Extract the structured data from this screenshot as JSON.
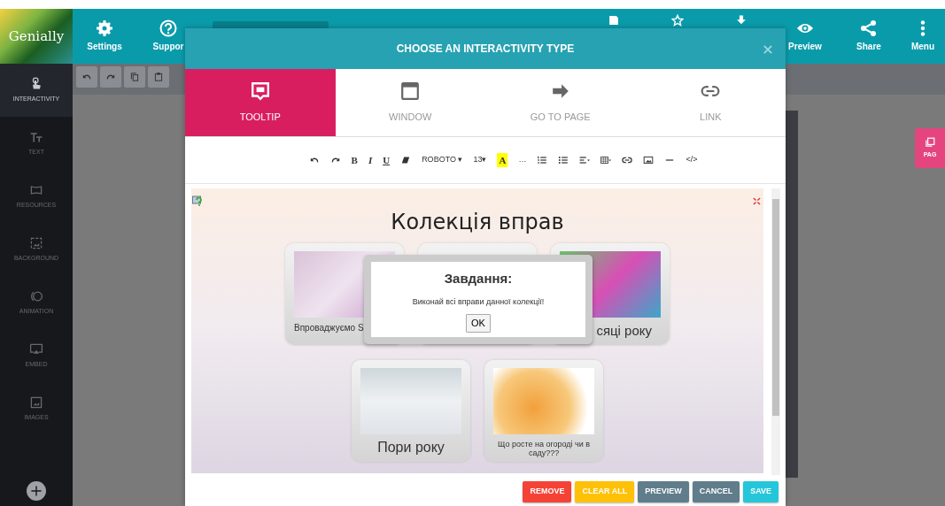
{
  "header": {
    "logo": "Genially",
    "left_items": [
      {
        "kind": "gear",
        "label": "Settings"
      },
      {
        "kind": "help",
        "label": "Suppor"
      }
    ],
    "right_items": [
      {
        "kind": "save"
      },
      {
        "kind": "star"
      },
      {
        "kind": "download"
      },
      {
        "kind": "eye",
        "label": "Preview"
      },
      {
        "kind": "share",
        "label": "Share"
      },
      {
        "kind": "dots",
        "label": "Menu"
      }
    ]
  },
  "sidebar": {
    "items": [
      {
        "kind": "hand",
        "label": "INTERACTIVITY",
        "selected": true
      },
      {
        "kind": "text",
        "label": "TEXT",
        "selected": false
      },
      {
        "kind": "resources",
        "label": "RESOURCES",
        "selected": false
      },
      {
        "kind": "background",
        "label": "BACKGROUND",
        "selected": false
      },
      {
        "kind": "animation",
        "label": "ANIMATION",
        "selected": false
      },
      {
        "kind": "embed",
        "label": "EMBED",
        "selected": false
      },
      {
        "kind": "images",
        "label": "IMAGES",
        "selected": false
      }
    ]
  },
  "canvas_toolbar": [
    {
      "kind": "undo"
    },
    {
      "kind": "redo"
    },
    {
      "kind": "copy"
    },
    {
      "kind": "paste"
    }
  ],
  "page_button": {
    "label": "PAG"
  },
  "modal": {
    "title": "CHOOSE AN INTERACTIVITY TYPE",
    "tabs": [
      {
        "kind": "tooltip",
        "label": "TOOLTIP",
        "selected": true
      },
      {
        "kind": "window",
        "label": "WINDOW",
        "selected": false
      },
      {
        "kind": "arrow",
        "label": "GO TO PAGE",
        "selected": false
      },
      {
        "kind": "link",
        "label": "LINK",
        "selected": false
      }
    ],
    "editor_toolbar": [
      {
        "kind": "undo"
      },
      {
        "kind": "redo"
      },
      {
        "kind": "text",
        "text": "B"
      },
      {
        "kind": "text",
        "text": "I"
      },
      {
        "kind": "text",
        "text": "U"
      },
      {
        "kind": "eraser"
      },
      {
        "kind": "text",
        "text": "ROBOTO ▾"
      },
      {
        "kind": "text",
        "text": "13▾"
      },
      {
        "kind": "highlight",
        "text": "A"
      },
      {
        "kind": "text",
        "text": "…"
      },
      {
        "kind": "ol"
      },
      {
        "kind": "ul"
      },
      {
        "kind": "align"
      },
      {
        "kind": "table"
      },
      {
        "kind": "link"
      },
      {
        "kind": "image"
      },
      {
        "kind": "hr"
      },
      {
        "kind": "text",
        "text": "</>"
      }
    ],
    "preview": {
      "title": "Колекція вправ",
      "rows": [
        [
          {
            "caption": "Впроваджуємо S",
            "photo": true
          },
          {
            "photo": false
          },
          {
            "caption": "сяці року",
            "photo": true
          }
        ],
        [
          {
            "caption": "Пори року",
            "photo": true
          },
          {
            "caption": "Що росте на огороді чи в саду???",
            "photo": true
          }
        ]
      ],
      "dialog": {
        "title": "Завдання:",
        "message": "Виконай всі вправи данної колекції!",
        "button": "OK"
      }
    },
    "buttons": [
      {
        "kind": "danger",
        "label": "REMOVE"
      },
      {
        "kind": "warning",
        "label": "CLEAR ALL"
      },
      {
        "kind": "secondary",
        "label": "PREVIEW"
      },
      {
        "kind": "secondary",
        "label": "CANCEL"
      },
      {
        "kind": "info",
        "label": "SAVE"
      }
    ]
  }
}
